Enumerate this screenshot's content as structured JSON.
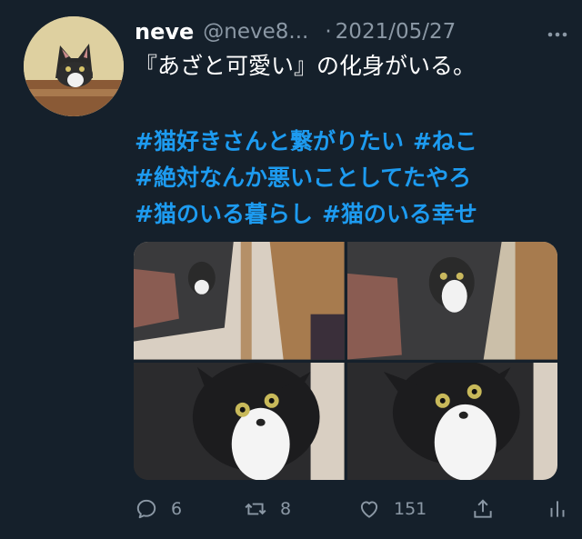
{
  "tweet": {
    "display_name": "neve",
    "handle": "@neve8...",
    "separator": "·",
    "date": "2021/05/27",
    "more_icon": "more-dots-icon",
    "text": "『あざと可愛い』の化身がいる。",
    "hashtags": [
      "#猫好きさんと繋がりたい",
      "#ねこ",
      "#絶対なんか悪いことしてたやろ",
      "#猫のいる暮らし",
      "#猫のいる幸せ"
    ],
    "media": [
      {
        "label": "cat-photo-1"
      },
      {
        "label": "cat-photo-2"
      },
      {
        "label": "cat-photo-3"
      },
      {
        "label": "cat-photo-4"
      }
    ]
  },
  "actions": {
    "reply_count": "6",
    "retweet_count": "8",
    "like_count": "151"
  },
  "colors": {
    "background": "#15202b",
    "accent": "#1d9bf0",
    "secondary_text": "#8b98a5"
  }
}
